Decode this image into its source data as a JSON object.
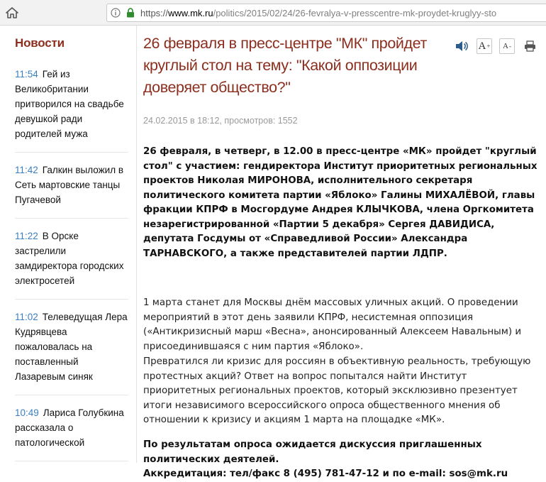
{
  "browser": {
    "url_scheme": "https://",
    "url_host": "www.mk.ru",
    "url_path": "/politics/2015/02/24/26-fevralya-v-presscentre-mk-proydet-kruglyy-sto"
  },
  "sidebar": {
    "title": "Новости",
    "items": [
      {
        "time": "11:54",
        "text": "Гей из Великобритании притворился на свадьбе девушкой ради родителей мужа"
      },
      {
        "time": "11:42",
        "text": "Галкин выложил в Сеть мартовские танцы Пугачевой"
      },
      {
        "time": "11:22",
        "text": "В Орске застрелили замдиректора городских электросетей"
      },
      {
        "time": "11:02",
        "text": "Телеведущая Лера Кудрявцева пожаловалась на поставленный Лазаревым синяк"
      },
      {
        "time": "10:49",
        "text": "Лариса Голубкина рассказала о патологической"
      }
    ]
  },
  "article": {
    "title": "26 февраля в пресс-центре \"МК\" пройдет круглый стол на тему: \"Какой оппозиции доверяет общество?\"",
    "meta": "24.02.2015 в 18:12, просмотров: 1552",
    "lead": "26 февраля, в четверг, в 12.00 в пресс-центре «МК» пройдет \"круглый стол\" с участием: гендиректора Институт приоритетных региональных проектов Николая МИРОНОВА, исполнительного секретаря политического комитета партии «Яблоко» Галины МИХАЛЁВОЙ, главы фракции КПРФ в Мосгордуме Андрея КЛЫЧКОВА, члена Оргкомитета незарегистрированной «Партии 5 декабря» Сергея ДАВИДИСА, депутата Госдумы от «Справедливой России» Александра ТАРНАВСКОГО, а также представителей партии ЛДПР.",
    "p1": "1 марта станет для Москвы днём массовых уличных акций. О проведении мероприятий в этот день заявили КПРФ, несистемная оппозиция («Антикризисный марш «Весна», анонсированный Алексеем Навальным) и присоединившаяся с ним партия «Яблоко».",
    "p2": "Превратился ли кризис для россиян в объективную реальность, требующую протестных акций? Ответ на вопрос попытался найти Институт приоритетных региональных проектов, который эксклюзивно презентует итоги независимого всероссийского опроса общественного мнения об отношении к кризису и акциям 1 марта на площадке «МК».",
    "p3": "По результатам опроса ожидается дискуссия приглашенных политических деятелей.",
    "p4": "Аккредитация: тел/факс 8 (495) 781-47-12 и по e-mail: sos@mk.ru"
  },
  "tools": {
    "font_increase": "A",
    "font_decrease": "A"
  },
  "colors": {
    "headline": "#8b2e1e",
    "time": "#3a7fc0"
  }
}
